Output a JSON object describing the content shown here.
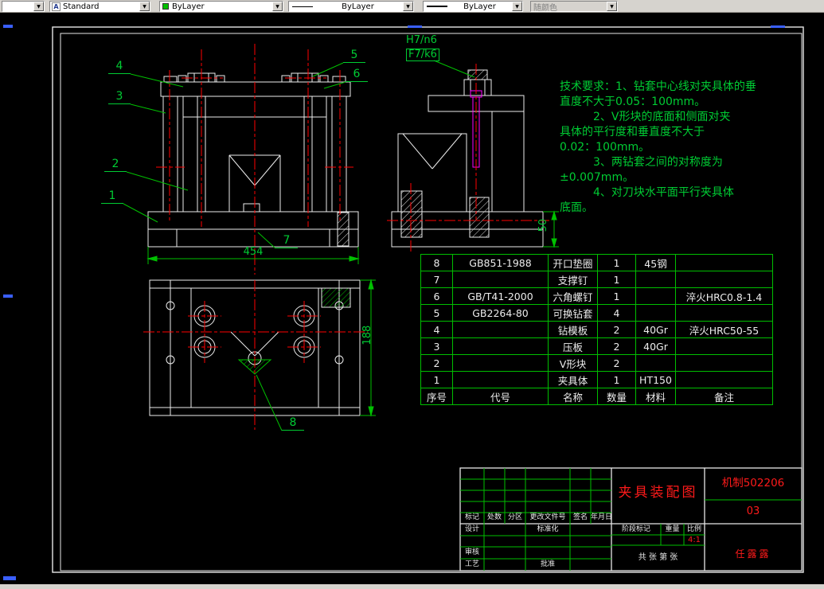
{
  "toolbar": {
    "layer_value": "",
    "text_style": "Standard",
    "color": "ByLayer",
    "linetype": "ByLayer",
    "lineweight": "ByLayer",
    "plot_style": "随颜色",
    "color_swatch": "#00c000"
  },
  "drawing": {
    "tech_requirements": [
      "技术要求：1、钻套中心线对夹具体的垂",
      "直度不大于0.05：100mm。",
      "　　　2、V形块的底面和侧面对夹",
      "具体的平行度和垂直度不大于",
      "0.02：100mm。",
      "　　　3、两钻套之间的对称度为",
      "±0.007mm。",
      "　　　4、对刀块水平面平行夹具体",
      "底面。"
    ],
    "dimensions": {
      "front_width": "454",
      "plan_depth": "188",
      "side_height": "50"
    },
    "fits": {
      "top": "H7/n6",
      "bottom": "F7/k6"
    },
    "balloons": [
      "1",
      "2",
      "3",
      "4",
      "5",
      "6",
      "7",
      "8"
    ]
  },
  "parts_table": {
    "headers": [
      "序号",
      "代号",
      "名称",
      "数量",
      "材料",
      "备注"
    ],
    "rows": [
      [
        "8",
        "GB851-1988",
        "开口垫圈",
        "1",
        "45钢",
        ""
      ],
      [
        "7",
        "",
        "支撑钉",
        "1",
        "",
        ""
      ],
      [
        "6",
        "GB/T41-2000",
        "六角螺钉",
        "1",
        "",
        "淬火HRC0.8-1.4"
      ],
      [
        "5",
        "GB2264-80",
        "可换钻套",
        "4",
        "",
        ""
      ],
      [
        "4",
        "",
        "钻模板",
        "2",
        "40Gr",
        "淬火HRC50-55"
      ],
      [
        "3",
        "",
        "压板",
        "2",
        "40Gr",
        ""
      ],
      [
        "2",
        "",
        "V形块",
        "2",
        "",
        ""
      ],
      [
        "1",
        "",
        "夹具体",
        "1",
        "HT150",
        ""
      ]
    ]
  },
  "title_block": {
    "title": "夹具装配图",
    "drawing_number": "机制502206",
    "sheet_code": "03",
    "signature": "任露露",
    "revision_headers": [
      "标记",
      "处数",
      "分区",
      "更改文件号",
      "签名",
      "年月日"
    ],
    "labels": {
      "design": "设计",
      "standardization": "标准化",
      "check": "审核",
      "process": "工艺",
      "approve": "批准",
      "stage_mark": "阶段标记",
      "weight": "重量",
      "scale": "比例",
      "scale_value": "4:1",
      "sheet_info": "共 张 第 张"
    }
  }
}
